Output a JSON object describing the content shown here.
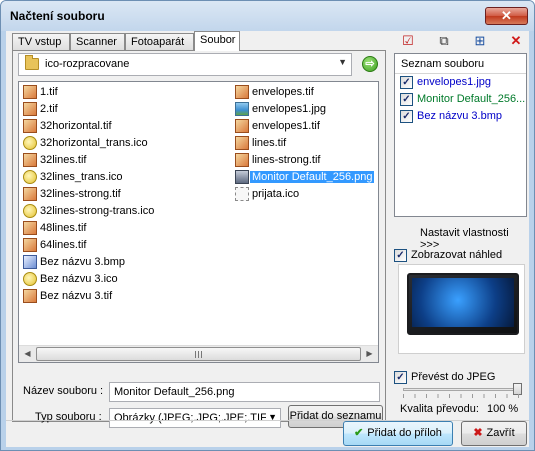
{
  "window": {
    "title": "Načtení souboru",
    "close_glyph": "✕"
  },
  "tabs": [
    {
      "label": "TV vstup"
    },
    {
      "label": "Scanner"
    },
    {
      "label": "Fotoaparát"
    },
    {
      "label": "Soubor"
    }
  ],
  "folder": {
    "current": "ico-rozpracovane",
    "go_glyph": "⇨",
    "dropdown_glyph": "▼"
  },
  "files_left": [
    {
      "name": "1.tif",
      "icon": "tif-icon"
    },
    {
      "name": "2.tif",
      "icon": "tif-icon"
    },
    {
      "name": "32horizontal.tif",
      "icon": "tif-icon"
    },
    {
      "name": "32horizontal_trans.ico",
      "icon": "ico-icon"
    },
    {
      "name": "32lines.tif",
      "icon": "tif-icon"
    },
    {
      "name": "32lines_trans.ico",
      "icon": "ico-icon"
    },
    {
      "name": "32lines-strong.tif",
      "icon": "tif-icon"
    },
    {
      "name": "32lines-strong-trans.ico",
      "icon": "ico-icon"
    },
    {
      "name": "48lines.tif",
      "icon": "tif-icon"
    },
    {
      "name": "64lines.tif",
      "icon": "tif-icon"
    },
    {
      "name": "Bez názvu 3.bmp",
      "icon": "bmp-icon"
    },
    {
      "name": "Bez názvu 3.ico",
      "icon": "ico-icon"
    },
    {
      "name": "Bez názvu 3.tif",
      "icon": "tif-icon"
    }
  ],
  "files_right": [
    {
      "name": "envelopes.tif",
      "icon": "tif-icon"
    },
    {
      "name": "envelopes1.jpg",
      "icon": "jpg-icon"
    },
    {
      "name": "envelopes1.tif",
      "icon": "tif-icon"
    },
    {
      "name": "lines.tif",
      "icon": "tif-icon"
    },
    {
      "name": "lines-strong.tif",
      "icon": "tif-icon"
    },
    {
      "name": "Monitor Default_256.png",
      "icon": "png-icon",
      "selected": true
    },
    {
      "name": "prijata.ico",
      "icon": "other-icon"
    }
  ],
  "form": {
    "filename_label": "Název souboru :",
    "filename_value": "Monitor Default_256.png",
    "filetype_label": "Typ souboru :",
    "filetype_value": "Obrázky (JPEG;.JPG;.JPE;.TIF",
    "add_to_list_label": "Přidat do seznamu"
  },
  "right_panel": {
    "toolbar_icons": [
      "check-all-icon",
      "copy-icon",
      "add-icon",
      "delete-icon"
    ],
    "list_header": "Seznam souboru",
    "list_items": [
      {
        "name": "envelopes1.jpg",
        "checked": true
      },
      {
        "name": "Monitor Default_256...",
        "checked": true,
        "color": "#007a2a"
      },
      {
        "name": "Bez názvu 3.bmp",
        "checked": true
      }
    ],
    "set_properties": "Nastavit vlastnosti >>>",
    "preview_label": "Zobrazovat náhled",
    "convert_label": "Převést do JPEG",
    "quality_label": "Kvalita převodu:",
    "quality_value": "100 %",
    "quality_level": 1.0
  },
  "buttons": {
    "ok_label": "Přidat do příloh",
    "cancel_label": "Zavřít"
  }
}
